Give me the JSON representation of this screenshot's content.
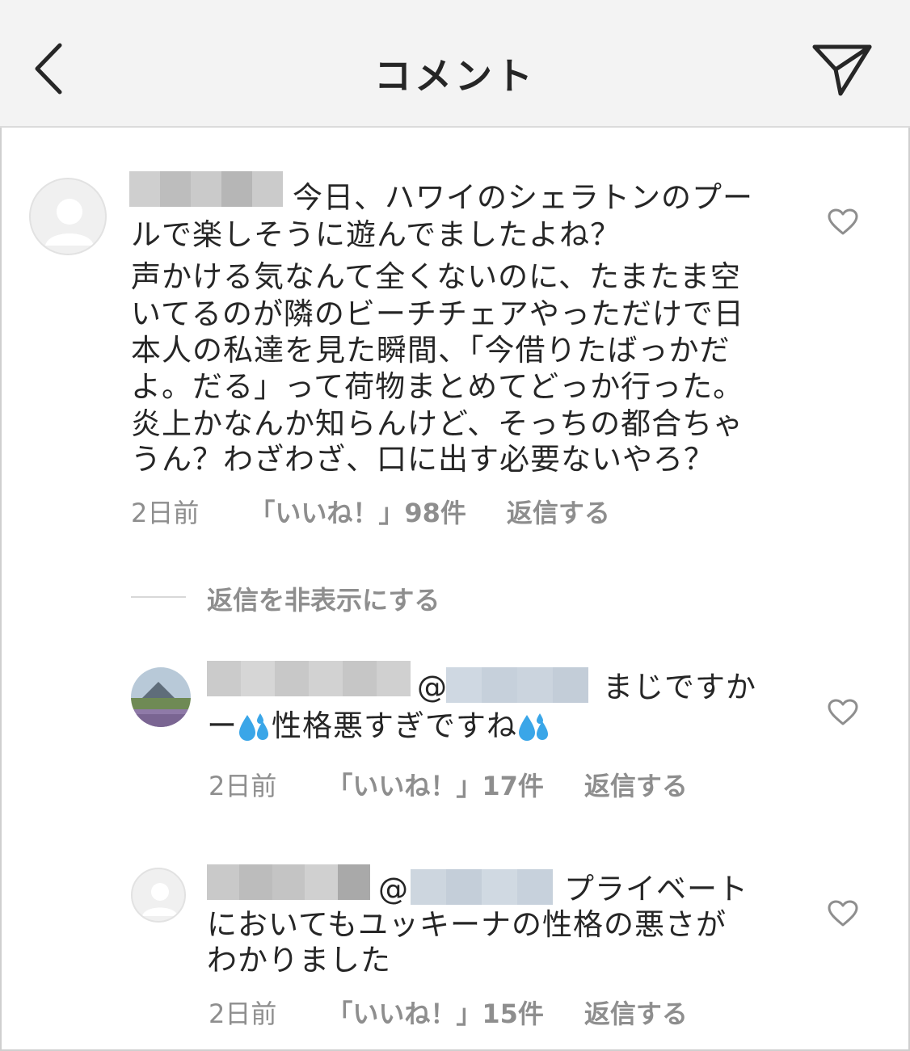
{
  "header": {
    "title": "コメント",
    "back_icon": "chevron-left-icon",
    "share_icon": "paper-plane-icon"
  },
  "comments": [
    {
      "lines": [
        "今日、ハワイのシェラトンのプー",
        "ルで楽しそうに遊んでましたよね？",
        "声かける気なんて全くないのに、たまたま空",
        "いてるのが隣のビーチチェアやっただけで日",
        "本人の私達を見た瞬間、「今借りたばっかだ",
        "よ。だる」って荷物まとめてどっか行った。",
        "炎上かなんか知らんけど、そっちの都合ちゃ",
        "うん？わざわざ、口に出す必要ないやろ？"
      ],
      "time": "2日前",
      "likes": "「いいね！」98件",
      "reply": "返信する"
    }
  ],
  "hide_replies": "返信を非表示にする",
  "replies": [
    {
      "mention": "@",
      "line1_tail": "まじですか",
      "line2_a": "ー",
      "line2_b": "性格悪すぎですね",
      "time": "2日前",
      "likes": "「いいね！」17件",
      "reply": "返信する"
    },
    {
      "mention": "@",
      "line1_tail": "プライベート",
      "line2": "においてもユッキーナの性格の悪さが",
      "line3": "わかりました",
      "time": "2日前",
      "likes": "「いいね！」15件",
      "reply": "返信する"
    }
  ],
  "colors": {
    "text": "#262626",
    "secondary": "#8e8e8e",
    "header_bg": "#f3f3f3",
    "blur_gray": "#c8c8c8",
    "blur_blue": "#c9d3de",
    "drop_blue": "#3aa6e8"
  }
}
